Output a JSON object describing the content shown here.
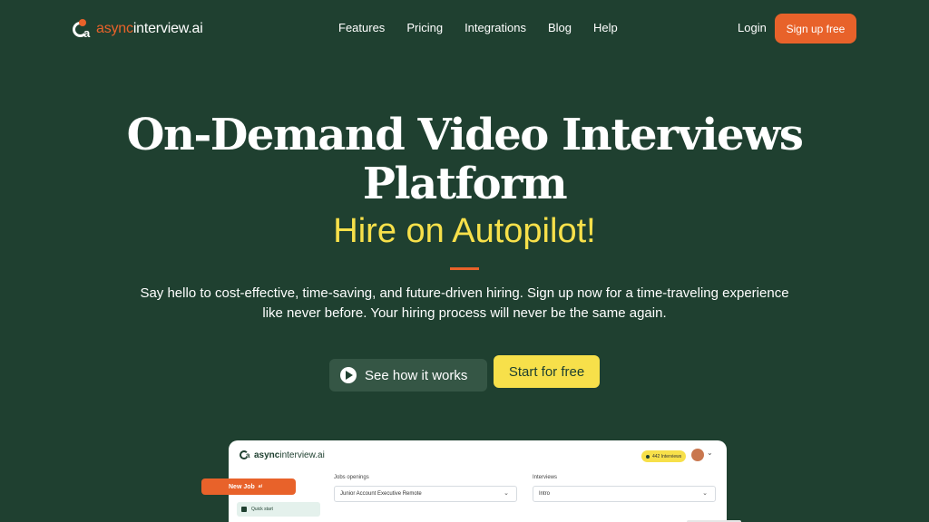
{
  "brand": {
    "logo_prefix": "async",
    "logo_suffix": "interview.ai",
    "accent": "#e8622a",
    "highlight": "#f7e04a",
    "background": "#1f4030"
  },
  "nav": {
    "links": [
      "Features",
      "Pricing",
      "Integrations",
      "Blog",
      "Help"
    ],
    "login": "Login",
    "signup": "Sign up free"
  },
  "hero": {
    "title_line1": "On-Demand Video Interviews",
    "title_line2": "Platform",
    "subtitle": "Hire on Autopilot!",
    "description": "Say hello to cost-effective, time-saving, and future-driven hiring. Sign up now for a time-traveling experience like never before. Your hiring process will never be the same again.",
    "see_how": "See how it works",
    "start_free": "Start for free",
    "play_icon": "play-icon"
  },
  "preview": {
    "logo_prefix": "async",
    "logo_suffix": "interview.ai",
    "badge": "442 Interviews",
    "new_job": "New Job",
    "new_job_tag": "ai",
    "quick_start": "Quick start",
    "jobs_label": "Jobs openings",
    "jobs_value": "Junior Account Executive Remote",
    "interviews_label": "Interviews",
    "interviews_value": "Intro"
  }
}
